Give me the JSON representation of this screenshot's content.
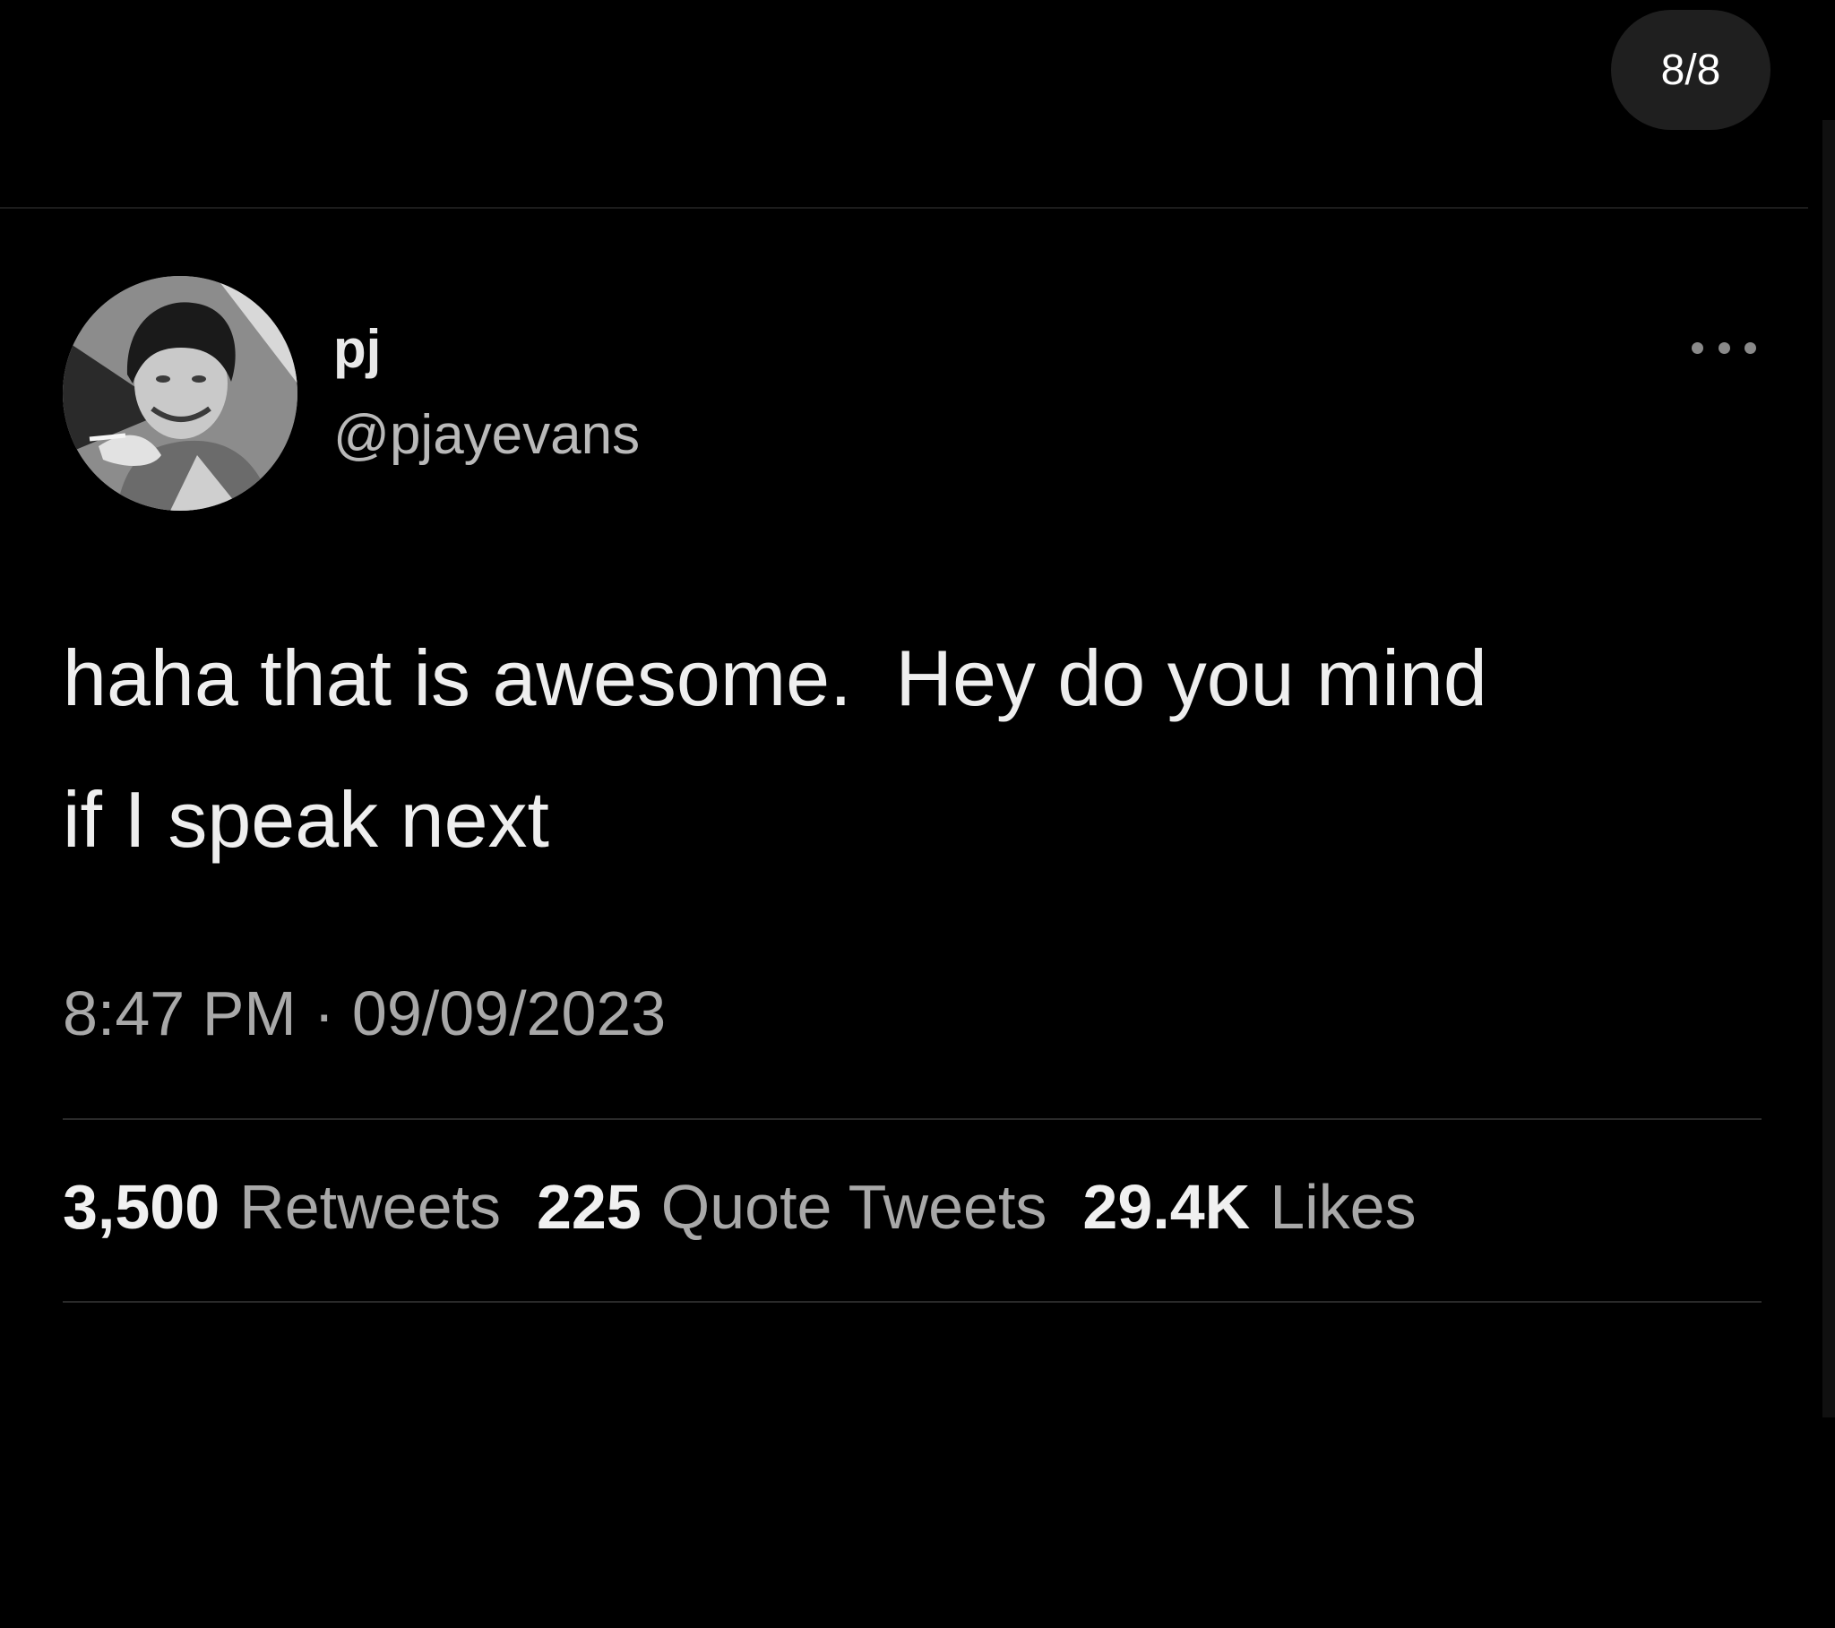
{
  "viewer": {
    "page_counter": "8/8"
  },
  "tweet": {
    "display_name": "pj",
    "handle": "@pjayevans",
    "text_line1": "haha that is awesome.  Hey do you mind",
    "text_line2": "if I speak next",
    "timestamp": "8:47 PM · 09/09/2023",
    "more_icon": "ellipsis-icon",
    "avatar_icon": "profile-photo"
  },
  "stats": {
    "retweets_count": "3,500",
    "retweets_label": "Retweets",
    "quotes_count": "225",
    "quotes_label": "Quote Tweets",
    "likes_count": "29.4K",
    "likes_label": "Likes"
  },
  "colors": {
    "background": "#000000",
    "text_primary": "#eeeeee",
    "text_secondary": "#a8a8a8"
  }
}
